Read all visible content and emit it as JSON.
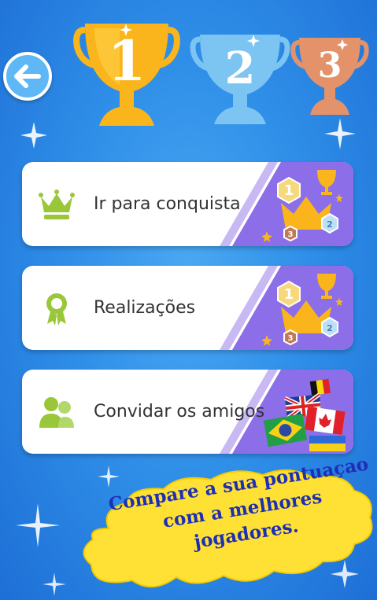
{
  "trophies": [
    {
      "rank": "1",
      "color": "#f9b51b",
      "icon": "gold-trophy-icon"
    },
    {
      "rank": "2",
      "color": "#7cc4f2",
      "icon": "silver-trophy-icon"
    },
    {
      "rank": "3",
      "color": "#e4926a",
      "icon": "bronze-trophy-icon"
    }
  ],
  "menu": [
    {
      "label": "Ir para conquista",
      "icon": "crown-icon"
    },
    {
      "label": "Realizações",
      "icon": "award-ribbon-icon"
    },
    {
      "label": "Convidar os amigos",
      "icon": "people-icon"
    }
  ],
  "promo": {
    "lines": [
      "Compare a sua pontuaçao",
      "com a melhores",
      "jogadores."
    ]
  },
  "colors": {
    "accent_green": "#9ac73a",
    "card_stripe_purple": "#8b6ee8",
    "bubble_yellow": "#ffe135",
    "promo_text": "#1f2fb5"
  }
}
